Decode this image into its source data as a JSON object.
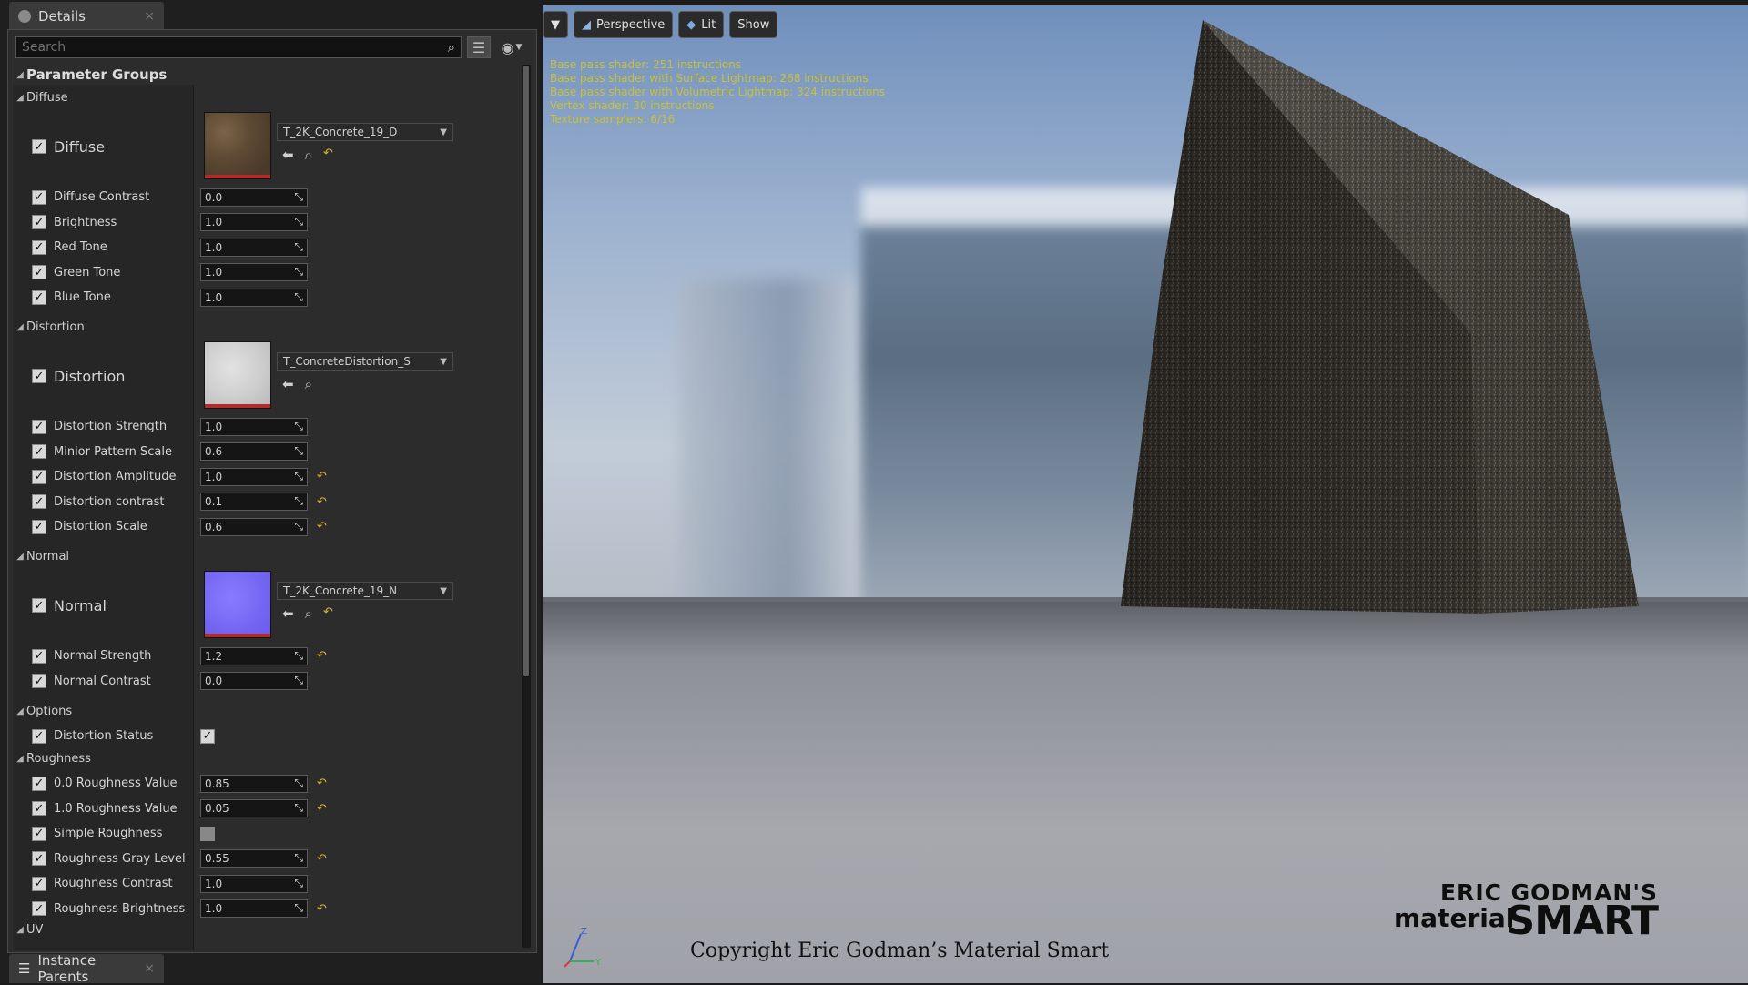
{
  "details_tab": {
    "title": "Details",
    "close": "×"
  },
  "instance_tab": {
    "title": "Instance Parents",
    "close": "×"
  },
  "search": {
    "placeholder": "Search"
  },
  "root_group": "Parameter Groups",
  "groups": {
    "diffuse": {
      "label": "Diffuse",
      "texture": {
        "name": "Diffuse",
        "asset": "T_2K_Concrete_19_D"
      },
      "params": [
        {
          "name": "Diffuse Contrast",
          "value": "0.0"
        },
        {
          "name": "Brightness",
          "value": "1.0"
        },
        {
          "name": "Red Tone",
          "value": "1.0"
        },
        {
          "name": "Green Tone",
          "value": "1.0"
        },
        {
          "name": "Blue Tone",
          "value": "1.0"
        }
      ]
    },
    "distortion": {
      "label": "Distortion",
      "texture": {
        "name": "Distortion",
        "asset": "T_ConcreteDistortion_S"
      },
      "params": [
        {
          "name": "Distortion Strength",
          "value": "1.0"
        },
        {
          "name": "Minior Pattern Scale",
          "value": "0.6"
        },
        {
          "name": "Distortion Amplitude",
          "value": "1.0"
        },
        {
          "name": "Distortion contrast",
          "value": "0.1"
        },
        {
          "name": "Distortion Scale",
          "value": "0.6"
        }
      ]
    },
    "normal": {
      "label": "Normal",
      "texture": {
        "name": "Normal",
        "asset": "T_2K_Concrete_19_N"
      },
      "params": [
        {
          "name": "Normal Strength",
          "value": "1.2"
        },
        {
          "name": "Normal Contrast",
          "value": "0.0"
        }
      ]
    },
    "options": {
      "label": "Options",
      "params": [
        {
          "name": "Distortion Status",
          "checked": true
        }
      ]
    },
    "roughness": {
      "label": "Roughness",
      "params": [
        {
          "name": "0.0 Roughness Value",
          "value": "0.85"
        },
        {
          "name": "1.0 Roughness Value",
          "value": "0.05"
        },
        {
          "name": "Simple Roughness",
          "checked": false
        },
        {
          "name": "Roughness Gray Level",
          "value": "0.55"
        },
        {
          "name": "Roughness Contrast",
          "value": "1.0"
        },
        {
          "name": "Roughness Brightness",
          "value": "1.0"
        }
      ]
    },
    "uv": {
      "label": "UV"
    }
  },
  "viewport": {
    "view_mode": "Perspective",
    "lighting": "Lit",
    "show": "Show",
    "stats": [
      "Base pass shader: 251 instructions",
      "Base pass shader with Surface Lightmap: 268 instructions",
      "Base pass shader with Volumetric Lightmap: 324 instructions",
      "Vertex shader: 30 instructions",
      "Texture samplers: 6/16"
    ],
    "copyright": "Copyright Eric Godman’s Material Smart",
    "logo": {
      "line1": "ERIC GODMAN'S",
      "line2": "material",
      "line3": "SMART"
    },
    "axis_labels": {
      "z": "Z",
      "y": "Y"
    }
  },
  "colors": {
    "reset_arrow": "#d8b23c",
    "stats_text": "#c9c13a",
    "panel_bg": "#2c2c2c"
  },
  "icons": [
    "details-icon",
    "search-icon",
    "list-view-icon",
    "eye-icon",
    "expand-arrow-icon",
    "checkbox-icon",
    "spin-arrows-icon",
    "reset-arrow-icon",
    "use-selected-arrow-icon",
    "browse-magnifier-icon",
    "dropdown-icon",
    "instance-parents-icon"
  ]
}
